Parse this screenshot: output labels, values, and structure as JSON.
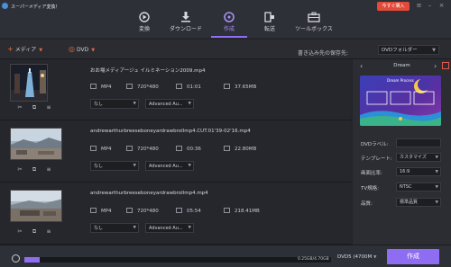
{
  "titlebar": {
    "app_title": "スーパーメディア変換！",
    "buy_label": "今すぐ購入",
    "nav": [
      {
        "label": "変換",
        "icon": "film-icon"
      },
      {
        "label": "ダウンロード",
        "icon": "download-icon"
      },
      {
        "label": "作成",
        "icon": "disc-icon",
        "active": true
      },
      {
        "label": "転送",
        "icon": "transfer-icon"
      },
      {
        "label": "ツールボックス",
        "icon": "toolbox-icon"
      }
    ]
  },
  "toolbar": {
    "add_media": "メディア",
    "add_dvd": "DVD",
    "save_to_label": "書き込み先の保存先:",
    "save_to_value": "DVDフォルダー"
  },
  "items": [
    {
      "filename": "おお場メディアージュ イルミネーション2009.mp4",
      "format": "MP4",
      "resolution": "720*480",
      "duration": "01:01",
      "size": "37.65MB",
      "subtitle": "なし",
      "audio": "Advanced Au..."
    },
    {
      "filename": "andrewarthurbreeseboneyardrawbrollmp4.CUT.01'39-02'16.mp4",
      "format": "MP4",
      "resolution": "720*480",
      "duration": "00:36",
      "size": "22.80MB",
      "subtitle": "なし",
      "audio": "Advanced Au..."
    },
    {
      "filename": "andrewarthurbreeseboneyardrawbrollmp4.mp4",
      "format": "MP4",
      "resolution": "720*480",
      "duration": "05:54",
      "size": "218.41MB",
      "subtitle": "なし",
      "audio": "Advanced Au..."
    }
  ],
  "panel": {
    "template_name": "Dream",
    "preview_title": "Dream Process",
    "props": [
      {
        "label": "DVDラベル:",
        "value": ""
      },
      {
        "label": "テンプレート:",
        "value": "カスタマイズ"
      },
      {
        "label": "画面比率:",
        "value": "16:9"
      },
      {
        "label": "TV規格:",
        "value": "NTSC"
      },
      {
        "label": "品質:",
        "value": "標準品質"
      }
    ]
  },
  "footer": {
    "size_text": "0.25GB/4.70GB",
    "disc_label": "DVD5 (4700M",
    "create_label": "作成",
    "progress": 0.05
  },
  "colors": {
    "accent": "#8e6df2",
    "buy": "#e04b3a",
    "add": "#e96a3a"
  }
}
